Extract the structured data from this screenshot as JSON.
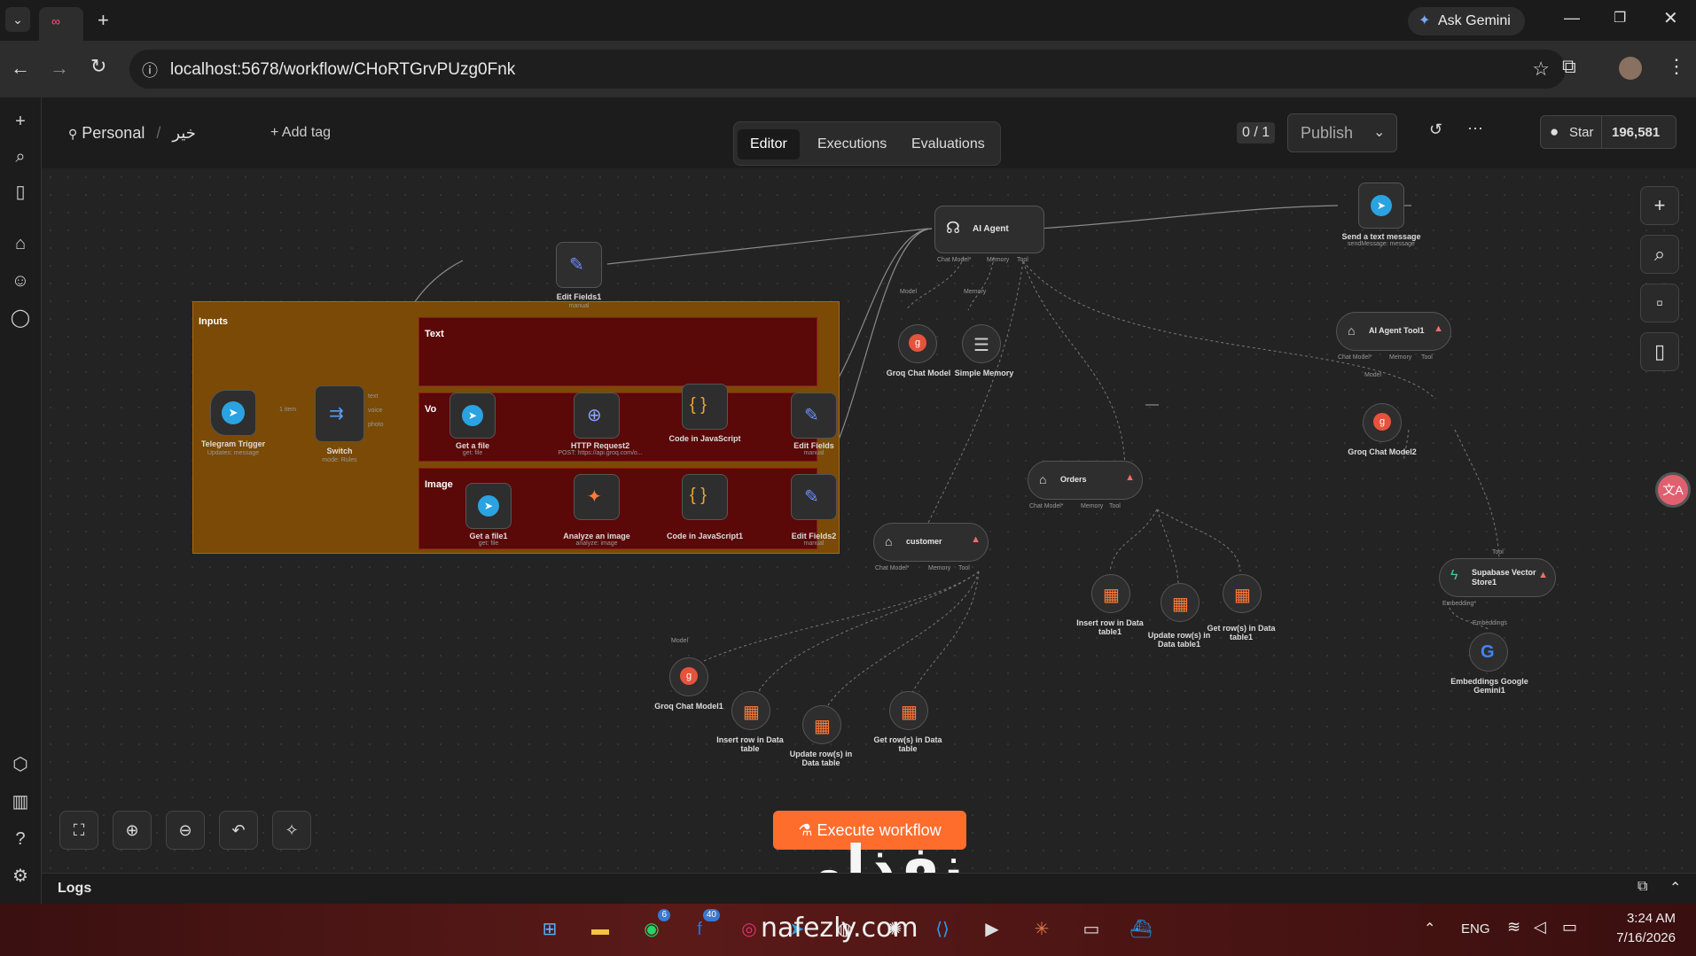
{
  "browser": {
    "url": "localhost:5678/workflow/CHoRTGrvPUzg0Fnk",
    "ask_gemini": "Ask Gemini",
    "new_tab": "+"
  },
  "header": {
    "project": "Personal",
    "workflow_name": "خير",
    "add_tag": "+ Add tag",
    "version": "0 / 1",
    "publish": "Publish",
    "star": "Star",
    "star_count": "196,581",
    "tabs": [
      "Editor",
      "Executions",
      "Evaluations"
    ]
  },
  "groups": {
    "inputs": "Inputs",
    "text": "Text",
    "voice": "Vo",
    "image": "Image"
  },
  "nodes": {
    "telegram_trigger": {
      "label": "Telegram Trigger",
      "sub": "Updates: message"
    },
    "switch": {
      "label": "Switch",
      "sub": "mode: Rules"
    },
    "switch_out_1": "text",
    "switch_out_2": "voice",
    "switch_out_3": "photo",
    "conn_items": "1 item",
    "edit_fields1": {
      "label": "Edit Fields1",
      "sub": "manual"
    },
    "get_a_file": {
      "label": "Get a file",
      "sub": "get: file"
    },
    "http_request2": {
      "label": "HTTP Request2",
      "sub": "POST: https://api.groq.com/o..."
    },
    "code_js": {
      "label": "Code in JavaScript"
    },
    "edit_fields": {
      "label": "Edit Fields",
      "sub": "manual"
    },
    "get_a_file1": {
      "label": "Get a file1",
      "sub": "get: file"
    },
    "analyze_image": {
      "label": "Analyze an image",
      "sub": "analyze: image"
    },
    "code_js1": {
      "label": "Code in JavaScript1"
    },
    "edit_fields2": {
      "label": "Edit Fields2",
      "sub": "manual"
    },
    "ai_agent": {
      "label": "AI Agent",
      "p_chat": "Chat Model*",
      "p_memory": "Memory",
      "p_tool": "Tool"
    },
    "groq_chat": {
      "label": "Groq Chat Model",
      "port": "Model"
    },
    "simple_memory": {
      "label": "Simple Memory",
      "port": "Memory"
    },
    "send_text": {
      "label": "Send a text message",
      "sub": "sendMessage: message"
    },
    "ai_agent_tool1": {
      "label": "AI Agent Tool1",
      "p_chat": "Chat Model*",
      "p_memory": "Memory",
      "p_tool": "Tool"
    },
    "groq_chat2": {
      "label": "Groq Chat Model2",
      "port": "Model"
    },
    "orders": {
      "label": "Orders",
      "p_chat": "Chat Model*",
      "p_memory": "Memory",
      "p_tool": "Tool"
    },
    "insert_row1": {
      "label": "Insert row in Data table1"
    },
    "update_rows1": {
      "label": "Update row(s) in Data table1"
    },
    "get_rows1": {
      "label": "Get row(s) in Data table1"
    },
    "customer": {
      "label": "customer",
      "p_chat": "Chat Model*",
      "p_memory": "Memory",
      "p_tool": "Tool"
    },
    "groq_chat1": {
      "label": "Groq Chat Model1",
      "port": "Model"
    },
    "insert_row": {
      "label": "Insert row in Data table"
    },
    "update_rows": {
      "label": "Update row(s) in Data table"
    },
    "get_rows": {
      "label": "Get row(s) in Data table"
    },
    "supabase": {
      "label": "Supabase Vector Store1",
      "p_tool": "Tool",
      "p_emb": "Embedding*",
      "p_embs": "Embeddings"
    },
    "embeddings": {
      "label": "Embeddings Google Gemini1"
    }
  },
  "canvas": {
    "execute": "Execute workflow"
  },
  "logs": "Logs",
  "watermark": {
    "arabic": "نفذلي",
    "latin": "nafezly.com"
  },
  "taskbar": {
    "lang": "ENG",
    "time": "3:24 AM",
    "date": "7/16/2026",
    "badge_whatsapp": "6",
    "badge_facebook": "40"
  },
  "colors": {
    "accent": "#ff6d2d",
    "group_inputs": "#7a4a06",
    "group_sub": "#5a0808",
    "warning": "#ff6b6b"
  }
}
